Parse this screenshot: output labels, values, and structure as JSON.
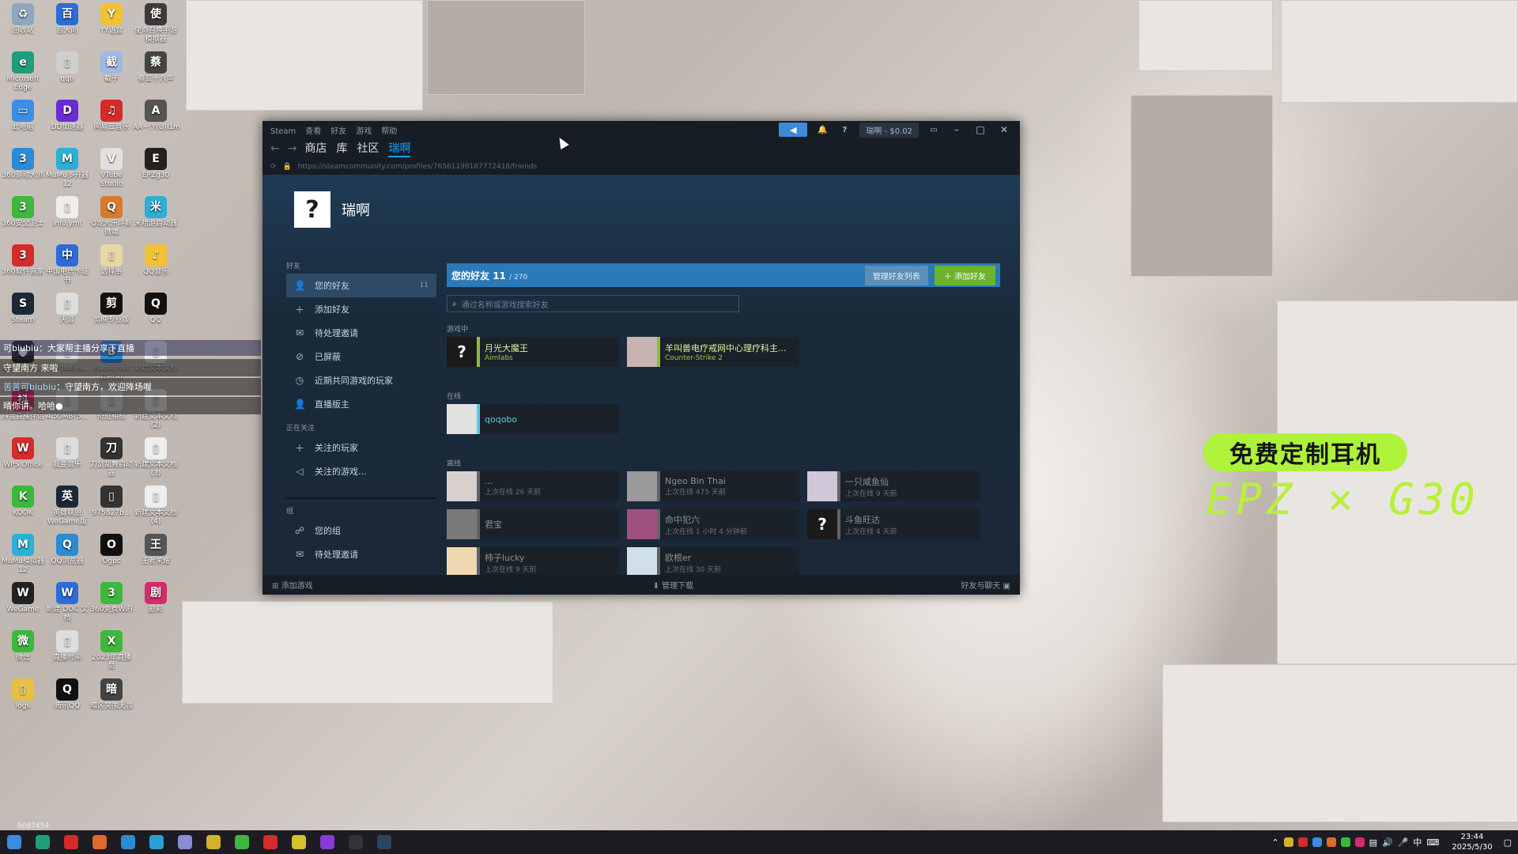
{
  "desktop": {
    "icons": [
      {
        "label": "回收站",
        "color": "#8fa8c0",
        "glyph": "♻"
      },
      {
        "label": "百大问",
        "color": "#2b6cd6",
        "glyph": "百"
      },
      {
        "label": "YY语音",
        "color": "#f1c232",
        "glyph": "Y"
      },
      {
        "label": "使命召唤手游模拟器",
        "color": "#3b3b3b",
        "glyph": "使"
      },
      {
        "label": "Microsoft Edge",
        "color": "#1e9e7a",
        "glyph": "e"
      },
      {
        "label": "qqb",
        "color": "#d0d0d0",
        "glyph": "▯"
      },
      {
        "label": "截子",
        "color": "#9fb8e8",
        "glyph": "截"
      },
      {
        "label": "蔡亚十六声",
        "color": "#444",
        "glyph": "蔡"
      },
      {
        "label": "此电脑",
        "color": "#3a8ee6",
        "glyph": "▭"
      },
      {
        "label": "DD加速器",
        "color": "#6a2bd6",
        "glyph": "D"
      },
      {
        "label": "网易云音乐",
        "color": "#d62b2b",
        "glyph": "♫"
      },
      {
        "label": "AA~!Y(U)I1m",
        "color": "#555",
        "glyph": "A"
      },
      {
        "label": "360驱动大师",
        "color": "#2b8bd6",
        "glyph": "3"
      },
      {
        "label": "MuMu多开器12",
        "color": "#2bb0d6",
        "glyph": "M"
      },
      {
        "label": "VTube Studio",
        "color": "#e0e0e0",
        "glyph": "V"
      },
      {
        "label": "EPZg30",
        "color": "#222",
        "glyph": "E"
      },
      {
        "label": "360安全卫士",
        "color": "#3cb83c",
        "glyph": "3"
      },
      {
        "label": "info.yml",
        "color": "#eee",
        "glyph": "▯"
      },
      {
        "label": "Q宠大乐斗新微端",
        "color": "#d67a2b",
        "glyph": "Q"
      },
      {
        "label": "米哈游启动器",
        "color": "#2bb0d6",
        "glyph": "米"
      },
      {
        "label": "360软件管家",
        "color": "#d62b2b",
        "glyph": "3"
      },
      {
        "label": "中国电信卡证书",
        "color": "#2b6cd6",
        "glyph": "中"
      },
      {
        "label": "选择事",
        "color": "#e8d8a0",
        "glyph": "▯"
      },
      {
        "label": "QQ音乐",
        "color": "#f1c232",
        "glyph": "♪"
      },
      {
        "label": "Steam",
        "color": "#1b2838",
        "glyph": "S"
      },
      {
        "label": "天涯",
        "color": "#ddd",
        "glyph": "▯"
      },
      {
        "label": "剪映专业版",
        "color": "#111",
        "glyph": "剪"
      },
      {
        "label": "QQ",
        "color": "#111",
        "glyph": "Q"
      },
      {
        "label": "OBS Studio",
        "color": "#222",
        "glyph": "●"
      },
      {
        "label": "a3206d98...",
        "color": "#ddd",
        "glyph": "▯"
      },
      {
        "label": "Battle.net (Beta)",
        "color": "#2b8bd6",
        "glyph": "B"
      },
      {
        "label": "新建文本文档",
        "color": "#eee",
        "glyph": "▯"
      },
      {
        "label": "抖音直播伴侣",
        "color": "#d62b6c",
        "glyph": "抖"
      },
      {
        "label": "4.50MB?5...",
        "color": "#ddd",
        "glyph": "▯"
      },
      {
        "label": "奇迹相框",
        "color": "#ddd",
        "glyph": "▯"
      },
      {
        "label": "新建文本文档(2)",
        "color": "#eee",
        "glyph": "▯"
      },
      {
        "label": "WPS Office",
        "color": "#d62b2b",
        "glyph": "W"
      },
      {
        "label": "我要音乐",
        "color": "#ddd",
        "glyph": "▯"
      },
      {
        "label": "刀剑乱舞启动器",
        "color": "#333",
        "glyph": "刀"
      },
      {
        "label": "新建文本文档(3)",
        "color": "#eee",
        "glyph": "▯"
      },
      {
        "label": "KOOK",
        "color": "#3cb83c",
        "glyph": "K"
      },
      {
        "label": "英雄联盟WeGame版",
        "color": "#1b2838",
        "glyph": "英"
      },
      {
        "label": "975827b...",
        "color": "#333",
        "glyph": "▯"
      },
      {
        "label": "新建文本文档(4)",
        "color": "#eee",
        "glyph": "▯"
      },
      {
        "label": "MuMu模拟器12",
        "color": "#2bb0d6",
        "glyph": "M"
      },
      {
        "label": "QQ浏览器",
        "color": "#2b8bd6",
        "glyph": "Q"
      },
      {
        "label": "Ogpc",
        "color": "#111",
        "glyph": "O"
      },
      {
        "label": "王者荣耀",
        "color": "#555",
        "glyph": "王"
      },
      {
        "label": "WeGame",
        "color": "#222",
        "glyph": "W"
      },
      {
        "label": "新建 DOC 文档",
        "color": "#2b6cd6",
        "glyph": "W"
      },
      {
        "label": "360免费WiFi",
        "color": "#3cb83c",
        "glyph": "3"
      },
      {
        "label": "剧彩",
        "color": "#d62b6c",
        "glyph": "剧"
      },
      {
        "label": "微信",
        "color": "#3cb83c",
        "glyph": "微"
      },
      {
        "label": "直播时间",
        "color": "#ddd",
        "glyph": "▯"
      },
      {
        "label": "2023年直播员",
        "color": "#3cb83c",
        "glyph": "X"
      },
      {
        "label": "",
        "color": "#00000000",
        "glyph": ""
      },
      {
        "label": "logs",
        "color": "#e8c040",
        "glyph": "▯"
      },
      {
        "label": "腾讯QQ",
        "color": "#111",
        "glyph": "Q"
      },
      {
        "label": "暗区突围无畏",
        "color": "#444",
        "glyph": "暗"
      }
    ],
    "overlay": {
      "line1": "可biubiu：大家帮主播分享下直播",
      "line2": "守望南方 来啦",
      "line3_name": "苦苦可biubiu",
      "line3_text": "守望南方，欢迎降场喔",
      "line4": "晴你讲。哈哈●"
    },
    "ad": {
      "badge": "免费定制耳机",
      "model": "EPZ × G30"
    },
    "counter": "9087454"
  },
  "steam": {
    "titlebar": {
      "menu": [
        "Steam",
        "查看",
        "好友",
        "游戏",
        "帮助"
      ],
      "wallet": "瑞啊 - $0.02"
    },
    "nav": {
      "tabs": [
        "商店",
        "库",
        "社区",
        "瑞啊"
      ],
      "url": "https://steamcommunity.com/profiles/76561199167772418/friends"
    },
    "profile": {
      "name": "瑞啊",
      "avatar_glyph": "?"
    },
    "sidebar": {
      "friends_header": "好友",
      "items": [
        {
          "label": "您的好友",
          "icon": "person-icon",
          "glyph": "👤",
          "count": "11"
        },
        {
          "label": "添加好友",
          "icon": "add-person-icon",
          "glyph": "＋",
          "count": ""
        },
        {
          "label": "待处理邀请",
          "icon": "mail-icon",
          "glyph": "✉",
          "count": ""
        },
        {
          "label": "已屏蔽",
          "icon": "block-icon",
          "glyph": "⊘",
          "count": ""
        },
        {
          "label": "近期共同游戏的玩家",
          "icon": "clock-icon",
          "glyph": "◷",
          "count": ""
        },
        {
          "label": "直播版主",
          "icon": "person-icon",
          "glyph": "👤",
          "count": ""
        }
      ],
      "following_header": "正在关注",
      "following": [
        {
          "label": "关注的玩家",
          "icon": "follow-person-icon",
          "glyph": "＋"
        },
        {
          "label": "关注的游戏...",
          "icon": "megaphone-icon",
          "glyph": "◁"
        }
      ],
      "groups_header": "组",
      "groups": [
        {
          "label": "您的组",
          "icon": "group-icon",
          "glyph": "☍"
        },
        {
          "label": "待处理邀请",
          "icon": "mail-icon",
          "glyph": "✉"
        }
      ]
    },
    "friends": {
      "title": "您的好友",
      "count": "11",
      "limit": "/ 270",
      "manage_label": "管理好友列表",
      "add_label": "添加好友",
      "search_placeholder": "通过名称或游戏搜索好友",
      "ingame_label": "游戏中",
      "online_label": "在线",
      "offline_label": "离线",
      "ingame": [
        {
          "name": "月光大魔王",
          "status": "Aimlabs",
          "avatar": "?",
          "avatar_bg": "#1a1a1a"
        },
        {
          "name": "羊叫兽电疗戒网中心理疗科主...",
          "status": "Counter-Strike 2",
          "avatar": "",
          "avatar_bg": "#c9b3b0"
        }
      ],
      "online": [
        {
          "name": "qoqobo",
          "status": "",
          "avatar": "",
          "avatar_bg": "#e0e0e0"
        }
      ],
      "offline": [
        {
          "name": "...",
          "status": "上次在线 26 天前",
          "avatar": "",
          "avatar_bg": "#d8d0cc"
        },
        {
          "name": "Ngeo Bin Thai",
          "status": "上次在线 475 天前",
          "avatar": "",
          "avatar_bg": "#9a9a9a"
        },
        {
          "name": "一只咸鱼仙",
          "status": "上次在线 9 天前",
          "avatar": "",
          "avatar_bg": "#d0c8d8"
        },
        {
          "name": "君宝",
          "status": "",
          "avatar": "",
          "avatar_bg": "#7a7a7a"
        },
        {
          "name": "命中犯六",
          "status": "上次在线 1 小时 4 分钟前",
          "avatar": "",
          "avatar_bg": "#a05080"
        },
        {
          "name": "斗鱼旺达",
          "status": "上次在线 4 天前",
          "avatar": "?",
          "avatar_bg": "#1a1a1a"
        },
        {
          "name": "柿子lucky",
          "status": "上次在线 9 天前",
          "avatar": "",
          "avatar_bg": "#f0d8b0"
        },
        {
          "name": "欧根er",
          "status": "上次在线 30 天前",
          "avatar": "",
          "avatar_bg": "#cfe0e8"
        }
      ]
    },
    "footer": {
      "add_game": "添加游戏",
      "manage_downloads": "管理下载",
      "friends_chat": "好友与聊天"
    }
  },
  "taskbar": {
    "apps": [
      {
        "name": "start",
        "color": "#3b8be0"
      },
      {
        "name": "edge",
        "color": "#1e9e7a"
      },
      {
        "name": "wps",
        "color": "#d62b2b"
      },
      {
        "name": "app4",
        "color": "#e06a2b"
      },
      {
        "name": "qq-browser",
        "color": "#2b8bd6"
      },
      {
        "name": "edge2",
        "color": "#2b9ed6"
      },
      {
        "name": "app7",
        "color": "#8a8ad6"
      },
      {
        "name": "app8",
        "color": "#d6b02b"
      },
      {
        "name": "wechat",
        "color": "#3cb83c"
      },
      {
        "name": "app10",
        "color": "#d62b2b"
      },
      {
        "name": "app11",
        "color": "#d6c02b"
      },
      {
        "name": "app12",
        "color": "#8a3bd6"
      },
      {
        "name": "app13",
        "color": "#333"
      },
      {
        "name": "steam",
        "color": "#2a475e"
      }
    ],
    "time": "23:44",
    "date": "2025/5/30",
    "ime": "中"
  }
}
